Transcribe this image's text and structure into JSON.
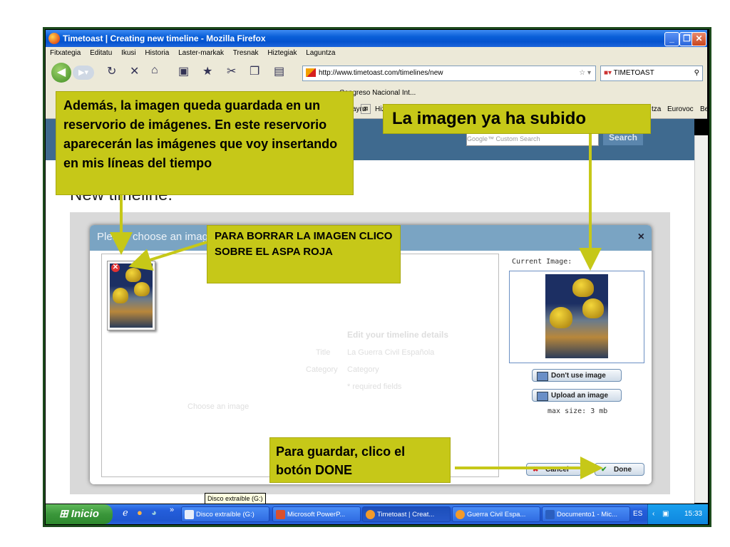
{
  "window": {
    "title": "Timetoast | Creating new timeline - Mozilla Firefox",
    "min": "_",
    "max": "❐",
    "close": "✕"
  },
  "menu": [
    "Fitxategia",
    "Editatu",
    "Ikusi",
    "Historia",
    "Laster-markak",
    "Tresnak",
    "Hiztegiak",
    "Laguntza"
  ],
  "nav": {
    "url": "http://www.timetoast.com/timelines/new",
    "search_engine": "TIMETOAST"
  },
  "bookmarks": {
    "visible": "Congreso Nacional Int..."
  },
  "tabs": {
    "items": [
      "ayru",
      "Hiz",
      "tza",
      "Eurovoc",
      "Be"
    ]
  },
  "site": {
    "search_placeholder": "Google™ Custom Search",
    "search_button": "Search",
    "page_title": "New timeline."
  },
  "dialog": {
    "title": "Please choose an image",
    "close": "×",
    "ghost_heading": "Edit your timeline details",
    "ghost_title_label": "Title",
    "ghost_title_value": "La Guerra Civil Española",
    "ghost_category_label": "Category",
    "ghost_category_value": "Category",
    "ghost_required": "* required fields",
    "ghost_choose": "Choose an image",
    "ghost_cancel": "Cancel",
    "current_image_label": "Current Image:",
    "dont_use_button": "Don't use image",
    "upload_button": "Upload an image",
    "max_size": "max size: 3 mb",
    "cancel_button": "Cancel",
    "done_button": "Done"
  },
  "callouts": {
    "gallery": "Además, la imagen queda guardada en un reservorio de imágenes. En este reservorio aparecerán las imágenes que voy insertando en mis líneas del tiempo",
    "uploaded": "La imagen  ya ha subido",
    "delete": "PARA BORRAR LA IMAGEN CLICO SOBRE EL ASPA ROJA",
    "save": "Para guardar, clico el botón DONE"
  },
  "taskbar": {
    "start": "Inicio",
    "overflow": "»",
    "tooltip": "Disco extraíble (G:)",
    "tasks": [
      "Disco extraíble (G:)",
      "Microsoft PowerP...",
      "Timetoast | Creat...",
      "Guerra Civil Espa...",
      "Documento1 - Mic..."
    ],
    "lang": "ES",
    "clock": "15:33"
  },
  "colors": {
    "callout": "#c6c818",
    "arrow": "#c6c818",
    "dialog_header": "#7aa4c3",
    "taskbar": "#245edb"
  }
}
